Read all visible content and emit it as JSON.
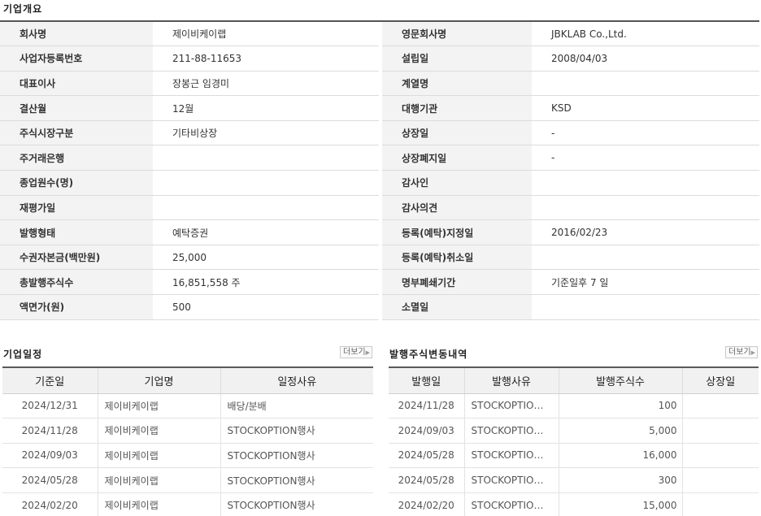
{
  "overview": {
    "title": "기업개요",
    "rows": [
      {
        "l1": "회사명",
        "v1": "제이비케이랩",
        "l2": "영문회사명",
        "v2": "JBKLAB Co.,Ltd."
      },
      {
        "l1": "사업자등록번호",
        "v1": "211-88-11653",
        "l2": "설립일",
        "v2": "2008/04/03"
      },
      {
        "l1": "대표이사",
        "v1": "장봉근 임경미",
        "l2": "계열명",
        "v2": ""
      },
      {
        "l1": "결산월",
        "v1": "12월",
        "l2": "대행기관",
        "v2": "KSD"
      },
      {
        "l1": "주식시장구분",
        "v1": "기타비상장",
        "l2": "상장일",
        "v2": "-"
      },
      {
        "l1": "주거래은행",
        "v1": "",
        "l2": "상장폐지일",
        "v2": "-"
      },
      {
        "l1": "종업원수(명)",
        "v1": "",
        "l2": "감사인",
        "v2": ""
      },
      {
        "l1": "재평가일",
        "v1": "",
        "l2": "감사의견",
        "v2": ""
      },
      {
        "l1": "발행형태",
        "v1": "예탁증권",
        "l2": "등록(예탁)지정일",
        "v2": "2016/02/23"
      },
      {
        "l1": "수권자본금(백만원)",
        "v1": "25,000",
        "l2": "등록(예탁)취소일",
        "v2": ""
      },
      {
        "l1": "총발행주식수",
        "v1": "16,851,558 주",
        "l2": "명부폐쇄기간",
        "v2": "기준일후 7 일"
      },
      {
        "l1": "액면가(원)",
        "v1": "500",
        "l2": "소멸일",
        "v2": ""
      }
    ]
  },
  "schedule": {
    "title": "기업일정",
    "more_label": "더보기",
    "headers": [
      "기준일",
      "기업명",
      "일정사유"
    ],
    "rows": [
      [
        "2024/12/31",
        "제이비케이랩",
        "배당/분배"
      ],
      [
        "2024/11/28",
        "제이비케이랩",
        "STOCKOPTION행사"
      ],
      [
        "2024/09/03",
        "제이비케이랩",
        "STOCKOPTION행사"
      ],
      [
        "2024/05/28",
        "제이비케이랩",
        "STOCKOPTION행사"
      ],
      [
        "2024/02/20",
        "제이비케이랩",
        "STOCKOPTION행사"
      ]
    ]
  },
  "issuance": {
    "title": "발행주식변동내역",
    "more_label": "더보기",
    "headers": [
      "발행일",
      "발행사유",
      "발행주식수",
      "상장일"
    ],
    "rows": [
      [
        "2024/11/28",
        "STOCKOPTIO…",
        "100",
        ""
      ],
      [
        "2024/09/03",
        "STOCKOPTIO…",
        "5,000",
        ""
      ],
      [
        "2024/05/28",
        "STOCKOPTIO…",
        "16,000",
        ""
      ],
      [
        "2024/05/28",
        "STOCKOPTIO…",
        "300",
        ""
      ],
      [
        "2024/02/20",
        "STOCKOPTIO…",
        "15,000",
        ""
      ]
    ]
  }
}
